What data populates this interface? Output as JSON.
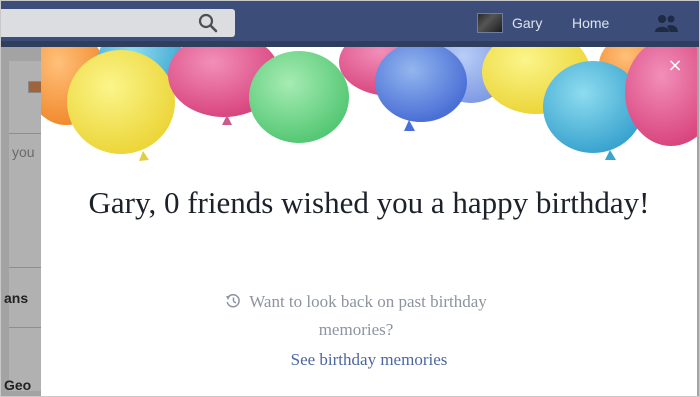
{
  "nav": {
    "user_name": "Gary",
    "home_label": "Home"
  },
  "background_page": {
    "snippets": [
      "you",
      "ans",
      "Geo"
    ]
  },
  "modal": {
    "headline": "Gary, 0 friends wished you a happy birthday!",
    "prompt": "Want to look back on past birthday memories?",
    "link": "See birthday memories",
    "close_symbol": "×"
  },
  "icons": {
    "search": "search-icon",
    "friends": "friends-icon",
    "history": "clock-history-icon",
    "close": "close-icon"
  },
  "colors": {
    "nav_bar": "#3b4d78",
    "link": "#4b67a1",
    "headline": "#1d2129",
    "muted_text": "#8d949e"
  }
}
